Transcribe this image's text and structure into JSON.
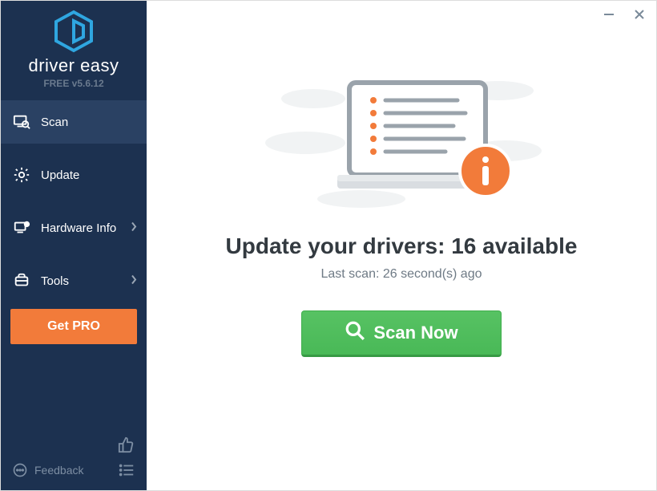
{
  "brand": {
    "name": "driver easy",
    "version": "FREE v5.6.12"
  },
  "nav": {
    "scan": "Scan",
    "update": "Update",
    "hardware": "Hardware Info",
    "tools": "Tools",
    "get_pro": "Get PRO",
    "feedback": "Feedback"
  },
  "main": {
    "headline_prefix": "Update your drivers: ",
    "headline_count": "16",
    "headline_suffix": " available",
    "last_scan": "Last scan: 26 second(s) ago",
    "scan_button": "Scan Now"
  }
}
